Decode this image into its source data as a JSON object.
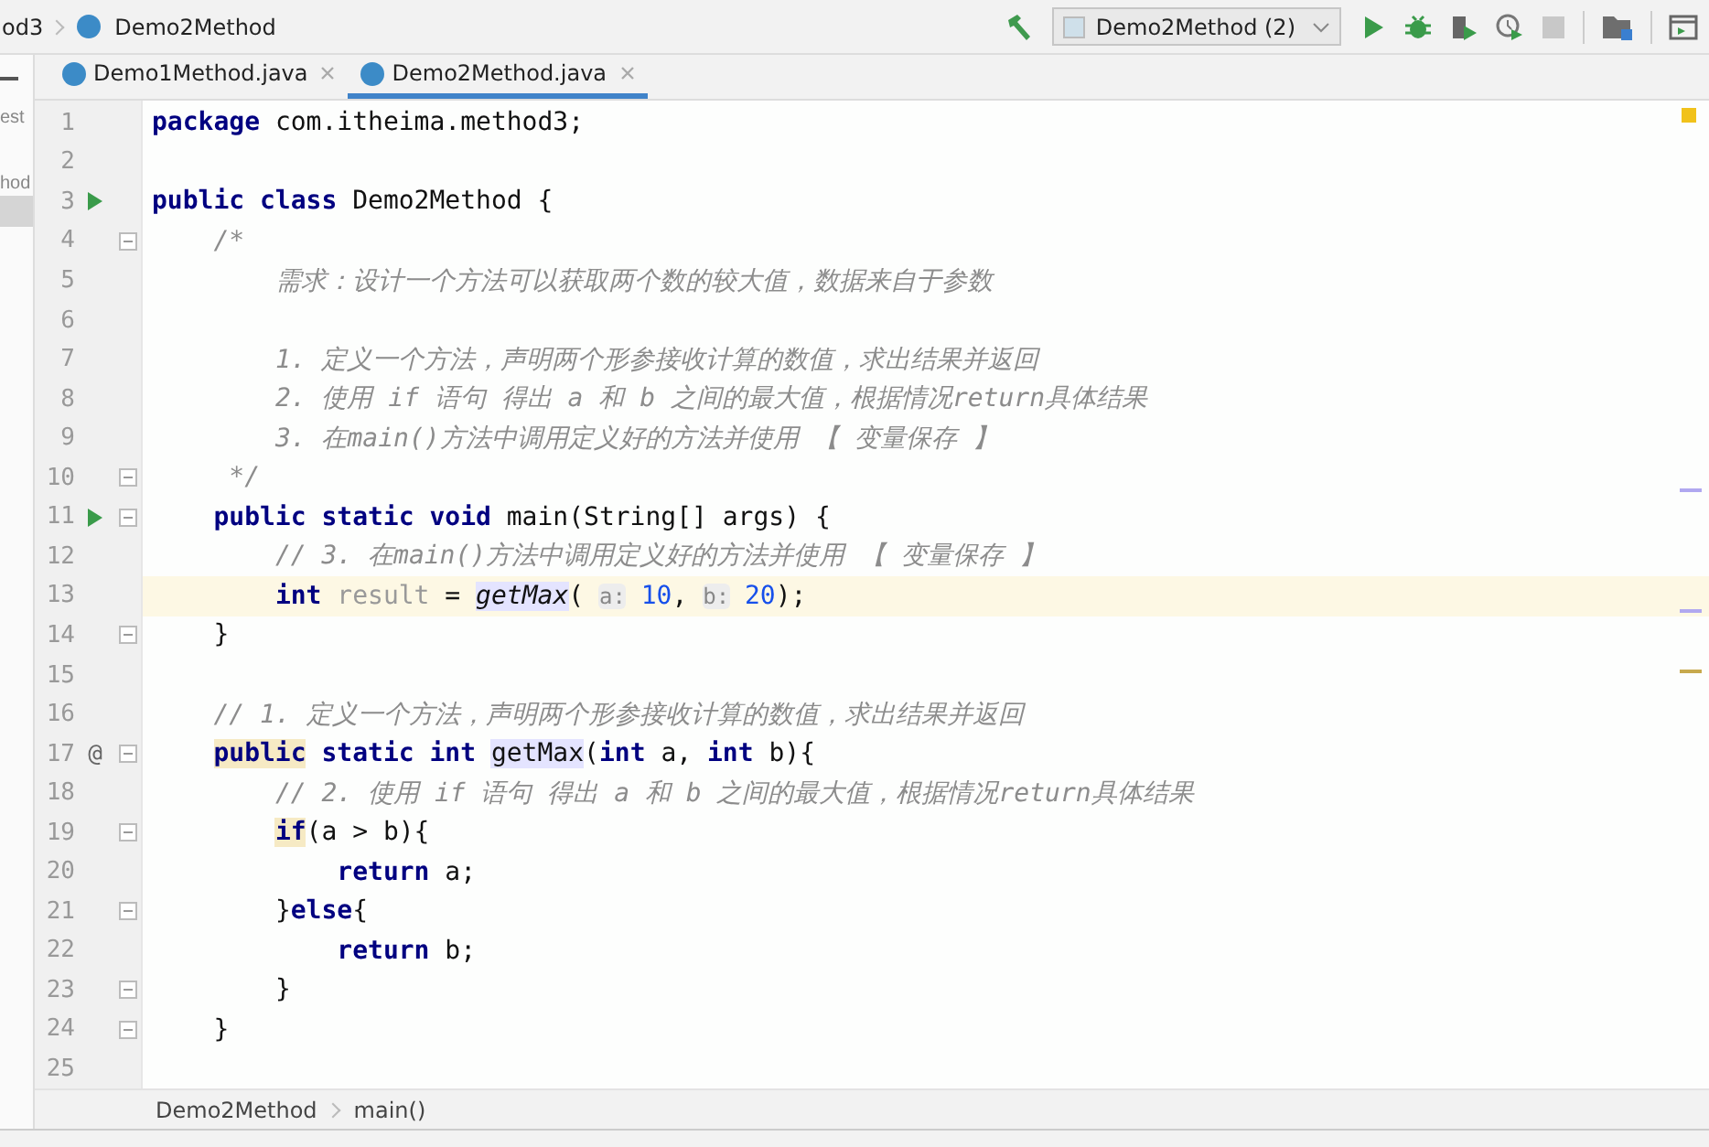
{
  "navbar": {
    "crumbs": [
      {
        "kind": "package",
        "text": "od3"
      },
      {
        "kind": "class",
        "text": "Demo2Method"
      }
    ],
    "run_config": "Demo2Method (2)"
  },
  "project_panel": {
    "fragments": [
      "est",
      "hod"
    ]
  },
  "tabs": [
    {
      "label": "Demo1Method.java",
      "selected": false
    },
    {
      "label": "Demo2Method.java",
      "selected": true
    }
  ],
  "editor": {
    "lines": [
      {
        "number": "1",
        "fold": false,
        "current": false,
        "tokens": [
          {
            "text": "package",
            "kind": "kw"
          },
          {
            "text": " com.itheima.method3;",
            "kind": "plain"
          }
        ]
      },
      {
        "number": "2",
        "fold": false,
        "current": false
      },
      {
        "number": "3",
        "fold": false,
        "current": false,
        "marker": {
          "kind": "run"
        },
        "tokens": [
          {
            "text": "public class",
            "kind": "kw"
          },
          {
            "text": " Demo2Method {",
            "kind": "plain"
          }
        ]
      },
      {
        "number": "4",
        "fold": true,
        "current": false,
        "tokens": [
          {
            "text": "    /*",
            "kind": "comment"
          }
        ]
      },
      {
        "number": "5",
        "fold": false,
        "current": false,
        "tokens": [
          {
            "text": "        需求：设计一个方法可以获取两个数的较大值，数据来自于参数",
            "kind": "comment"
          }
        ]
      },
      {
        "number": "6",
        "fold": false,
        "current": false
      },
      {
        "number": "7",
        "fold": false,
        "current": false,
        "tokens": [
          {
            "text": "        1. 定义一个方法，声明两个形参接收计算的数值，求出结果并返回",
            "kind": "comment"
          }
        ]
      },
      {
        "number": "8",
        "fold": false,
        "current": false,
        "tokens": [
          {
            "text": "        2. 使用 if 语句 得出 a 和 b 之间的最大值，根据情况return具体结果",
            "kind": "comment"
          }
        ]
      },
      {
        "number": "9",
        "fold": false,
        "current": false,
        "tokens": [
          {
            "text": "        3. 在main()方法中调用定义好的方法并使用 【 变量保存 】",
            "kind": "comment"
          }
        ]
      },
      {
        "number": "10",
        "fold": true,
        "current": false,
        "tokens": [
          {
            "text": "     */",
            "kind": "comment"
          }
        ]
      },
      {
        "number": "11",
        "fold": true,
        "current": false,
        "marker": {
          "kind": "run"
        },
        "tokens": [
          {
            "text": "    public static void",
            "kind": "kw"
          },
          {
            "text": " main(String[] args) {",
            "kind": "plain"
          }
        ]
      },
      {
        "number": "12",
        "fold": false,
        "current": false,
        "tokens": [
          {
            "text": "        // 3. 在main()方法中调用定义好的方法并使用 【 变量保存 】",
            "kind": "comment"
          }
        ]
      },
      {
        "number": "13",
        "fold": false,
        "current": true,
        "tokens": [
          {
            "text": "        int",
            "kind": "kw"
          },
          {
            "text": " result",
            "kind": "unused"
          },
          {
            "text": " = ",
            "kind": "plain"
          },
          {
            "text": "getMax",
            "kind": "call"
          },
          {
            "text": "( ",
            "kind": "plain"
          },
          {
            "text": "a:",
            "kind": "hint"
          },
          {
            "text": " 10",
            "kind": "num"
          },
          {
            "text": ", ",
            "kind": "plain"
          },
          {
            "text": "b:",
            "kind": "hint"
          },
          {
            "text": " 20",
            "kind": "num"
          },
          {
            "text": ");",
            "kind": "plain"
          }
        ]
      },
      {
        "number": "14",
        "fold": true,
        "current": false,
        "tokens": [
          {
            "text": "    }",
            "kind": "plain"
          }
        ]
      },
      {
        "number": "15",
        "fold": false,
        "current": false
      },
      {
        "number": "16",
        "fold": false,
        "current": false,
        "tokens": [
          {
            "text": "    // 1. 定义一个方法，声明两个形参接收计算的数值，求出结果并返回",
            "kind": "comment"
          }
        ]
      },
      {
        "number": "17",
        "fold": true,
        "current": false,
        "marker": {
          "kind": "symbol",
          "text": "@"
        },
        "tokens": [
          {
            "text": "    public",
            "kind": "kw-mark"
          },
          {
            "text": " static int ",
            "kind": "kw"
          },
          {
            "text": "getMax",
            "kind": "usage"
          },
          {
            "text": "(",
            "kind": "plain"
          },
          {
            "text": "int",
            "kind": "kw"
          },
          {
            "text": " a, ",
            "kind": "plain"
          },
          {
            "text": "int",
            "kind": "kw"
          },
          {
            "text": " b){",
            "kind": "plain"
          }
        ]
      },
      {
        "number": "18",
        "fold": false,
        "current": false,
        "tokens": [
          {
            "text": "        // 2. 使用 if 语句 得出 a 和 b 之间的最大值，根据情况return具体结果",
            "kind": "comment"
          }
        ]
      },
      {
        "number": "19",
        "fold": true,
        "current": false,
        "tokens": [
          {
            "text": "        if",
            "kind": "kw-mark"
          },
          {
            "text": "(a > b){",
            "kind": "plain"
          }
        ]
      },
      {
        "number": "20",
        "fold": false,
        "current": false,
        "tokens": [
          {
            "text": "            return",
            "kind": "kw"
          },
          {
            "text": " a;",
            "kind": "plain"
          }
        ]
      },
      {
        "number": "21",
        "fold": true,
        "current": false,
        "tokens": [
          {
            "text": "        }",
            "kind": "plain"
          },
          {
            "text": "else",
            "kind": "kw"
          },
          {
            "text": "{",
            "kind": "plain"
          }
        ]
      },
      {
        "number": "22",
        "fold": false,
        "current": false,
        "tokens": [
          {
            "text": "            return",
            "kind": "kw"
          },
          {
            "text": " b;",
            "kind": "plain"
          }
        ]
      },
      {
        "number": "23",
        "fold": true,
        "current": false,
        "tokens": [
          {
            "text": "        }",
            "kind": "plain"
          }
        ]
      },
      {
        "number": "24",
        "fold": true,
        "current": false,
        "tokens": [
          {
            "text": "    }",
            "kind": "plain"
          }
        ]
      },
      {
        "number": "25",
        "fold": false,
        "current": false
      }
    ]
  },
  "breadcrumbs": [
    "Demo2Method",
    "main()"
  ]
}
